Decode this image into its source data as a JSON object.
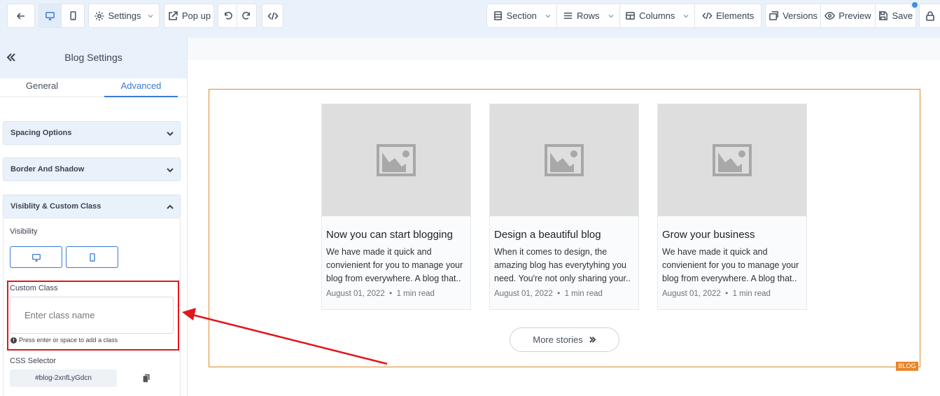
{
  "toolbar": {
    "settings_label": "Settings",
    "popup_label": "Pop up",
    "section_label": "Section",
    "rows_label": "Rows",
    "columns_label": "Columns",
    "elements_label": "Elements",
    "versions_label": "Versions",
    "preview_label": "Preview",
    "save_label": "Save"
  },
  "sidebar": {
    "title": "Blog Settings",
    "tabs": [
      "General",
      "Advanced"
    ],
    "active_tab": "Advanced",
    "accordions": [
      "Spacing Options",
      "Border And Shadow",
      "Visiblity & Custom Class"
    ],
    "visibility_label": "Visibility",
    "custom_class_label": "Custom Class",
    "custom_class_placeholder": "Enter class name",
    "custom_class_hint": "Press enter or space to add a class",
    "css_selector_label": "CSS Selector",
    "css_selector_value": "#blog-2xnfLyGdcn"
  },
  "blog": {
    "tag": "BLOG",
    "cards": [
      {
        "title": "Now you can start blogging",
        "body": "We have made it quick and convienient for you to manage your blog from everywhere. A blog that..",
        "date": "August 01, 2022",
        "read": "1 min read"
      },
      {
        "title": "Design a beautiful blog",
        "body": "When it comes to design, the amazing blog has everytyhing you need. You're not only sharing your..",
        "date": "August 01, 2022",
        "read": "1 min read"
      },
      {
        "title": "Grow your business",
        "body": "We have made it quick and convienient for you to manage your blog from everywhere. A blog that..",
        "date": "August 01, 2022",
        "read": "1 min read"
      }
    ],
    "more_label": "More stories"
  },
  "colors": {
    "accent": "#3a7bd5",
    "frame": "#e08a2a",
    "highlight": "#e3161b"
  }
}
